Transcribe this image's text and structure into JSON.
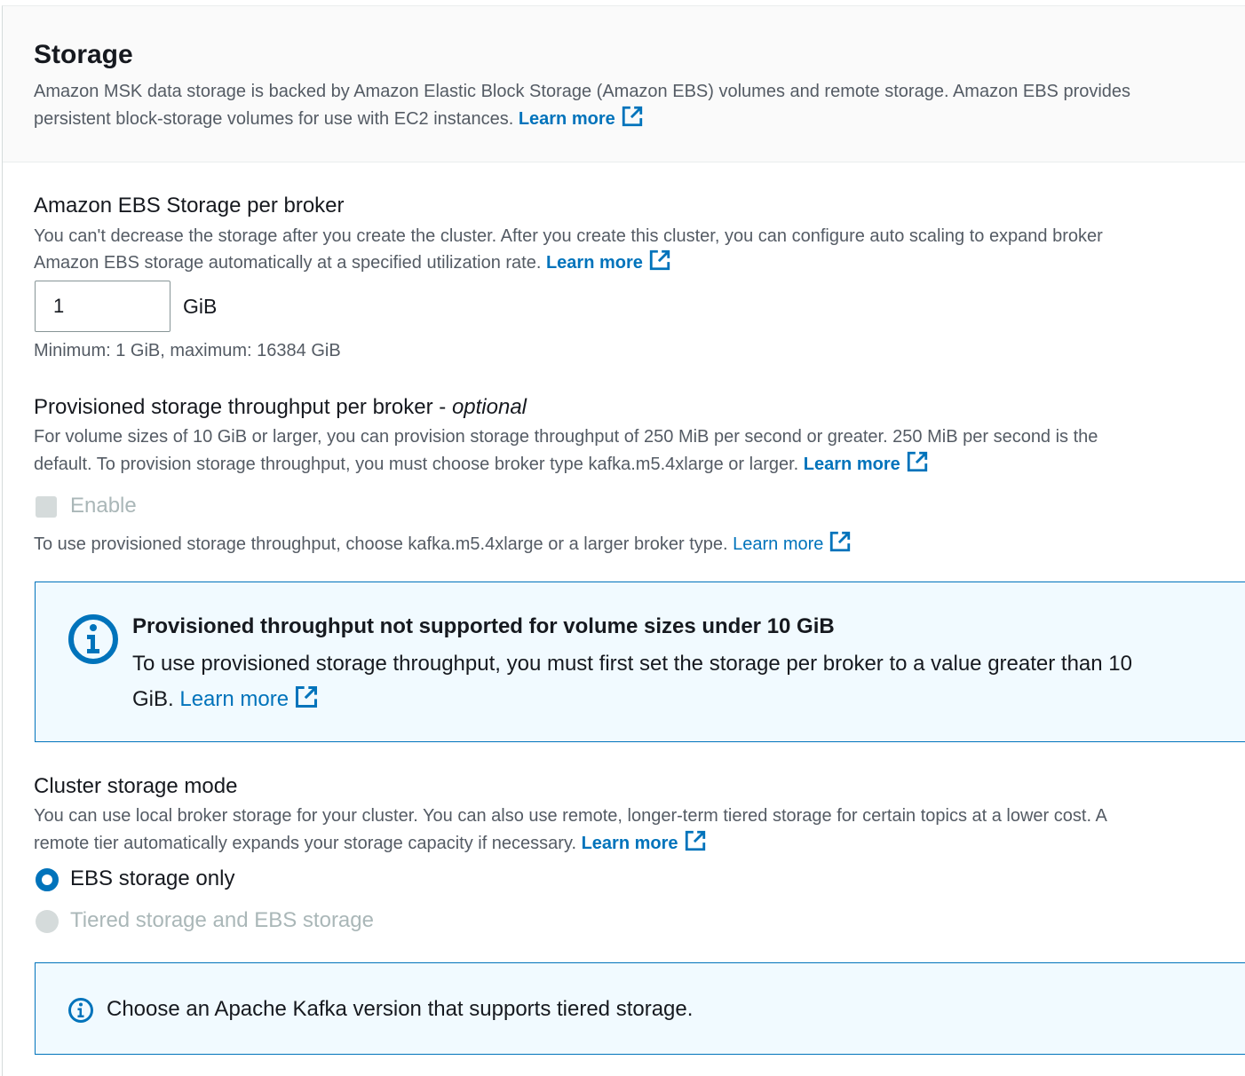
{
  "storage": {
    "title": "Storage",
    "desc_line1": "Amazon MSK data storage is backed by Amazon Elastic Block Storage (Amazon EBS) volumes and remote storage. Amazon EBS provides",
    "desc_line2": "persistent block-storage volumes for use with EC2 instances.",
    "learn_more": "Learn more"
  },
  "ebs": {
    "label": "Amazon EBS Storage per broker",
    "desc_line1": "You can't decrease the storage after you create the cluster. After you create this cluster, you can configure auto scaling to expand broker",
    "desc_line2": "Amazon EBS storage automatically at a specified utilization rate.",
    "learn_more": "Learn more",
    "value": "1",
    "unit": "GiB",
    "constraint": "Minimum: 1 GiB, maximum: 16384 GiB"
  },
  "throughput": {
    "label": "Provisioned storage throughput per broker - ",
    "label_optional": "optional",
    "desc_line1": "For volume sizes of 10 GiB or larger, you can provision storage throughput of 250 MiB per second or greater. 250 MiB per second is the",
    "desc_line2": "default. To provision storage throughput, you must choose broker type kafka.m5.4xlarge or larger.",
    "learn_more": "Learn more",
    "enable_label": "Enable",
    "enable_checked": false,
    "hint": "To use provisioned storage throughput, choose kafka.m5.4xlarge or a larger broker type.",
    "hint_learn_more": "Learn more"
  },
  "alert1": {
    "title": "Provisioned throughput not supported for volume sizes under 10 GiB",
    "text_line1": "To use provisioned storage throughput, you must first set the storage per broker to a value greater than 10",
    "text_line2": "GiB.",
    "learn_more": "Learn more"
  },
  "mode": {
    "label": "Cluster storage mode",
    "desc_line1": "You can use local broker storage for your cluster. You can also use remote, longer-term tiered storage for certain topics at a lower cost. A",
    "desc_line2": "remote tier automatically expands your storage capacity if necessary.",
    "learn_more": "Learn more",
    "option_ebs": "EBS storage only",
    "option_tiered": "Tiered storage and EBS storage",
    "selected": "EBS storage only"
  },
  "alert2": {
    "text": "Choose an Apache Kafka version that supports tiered storage."
  },
  "colors": {
    "link": "#0073bb",
    "alert_bg": "#f1faff",
    "alert_border": "#0073bb",
    "disabled": "#aab7b8"
  }
}
